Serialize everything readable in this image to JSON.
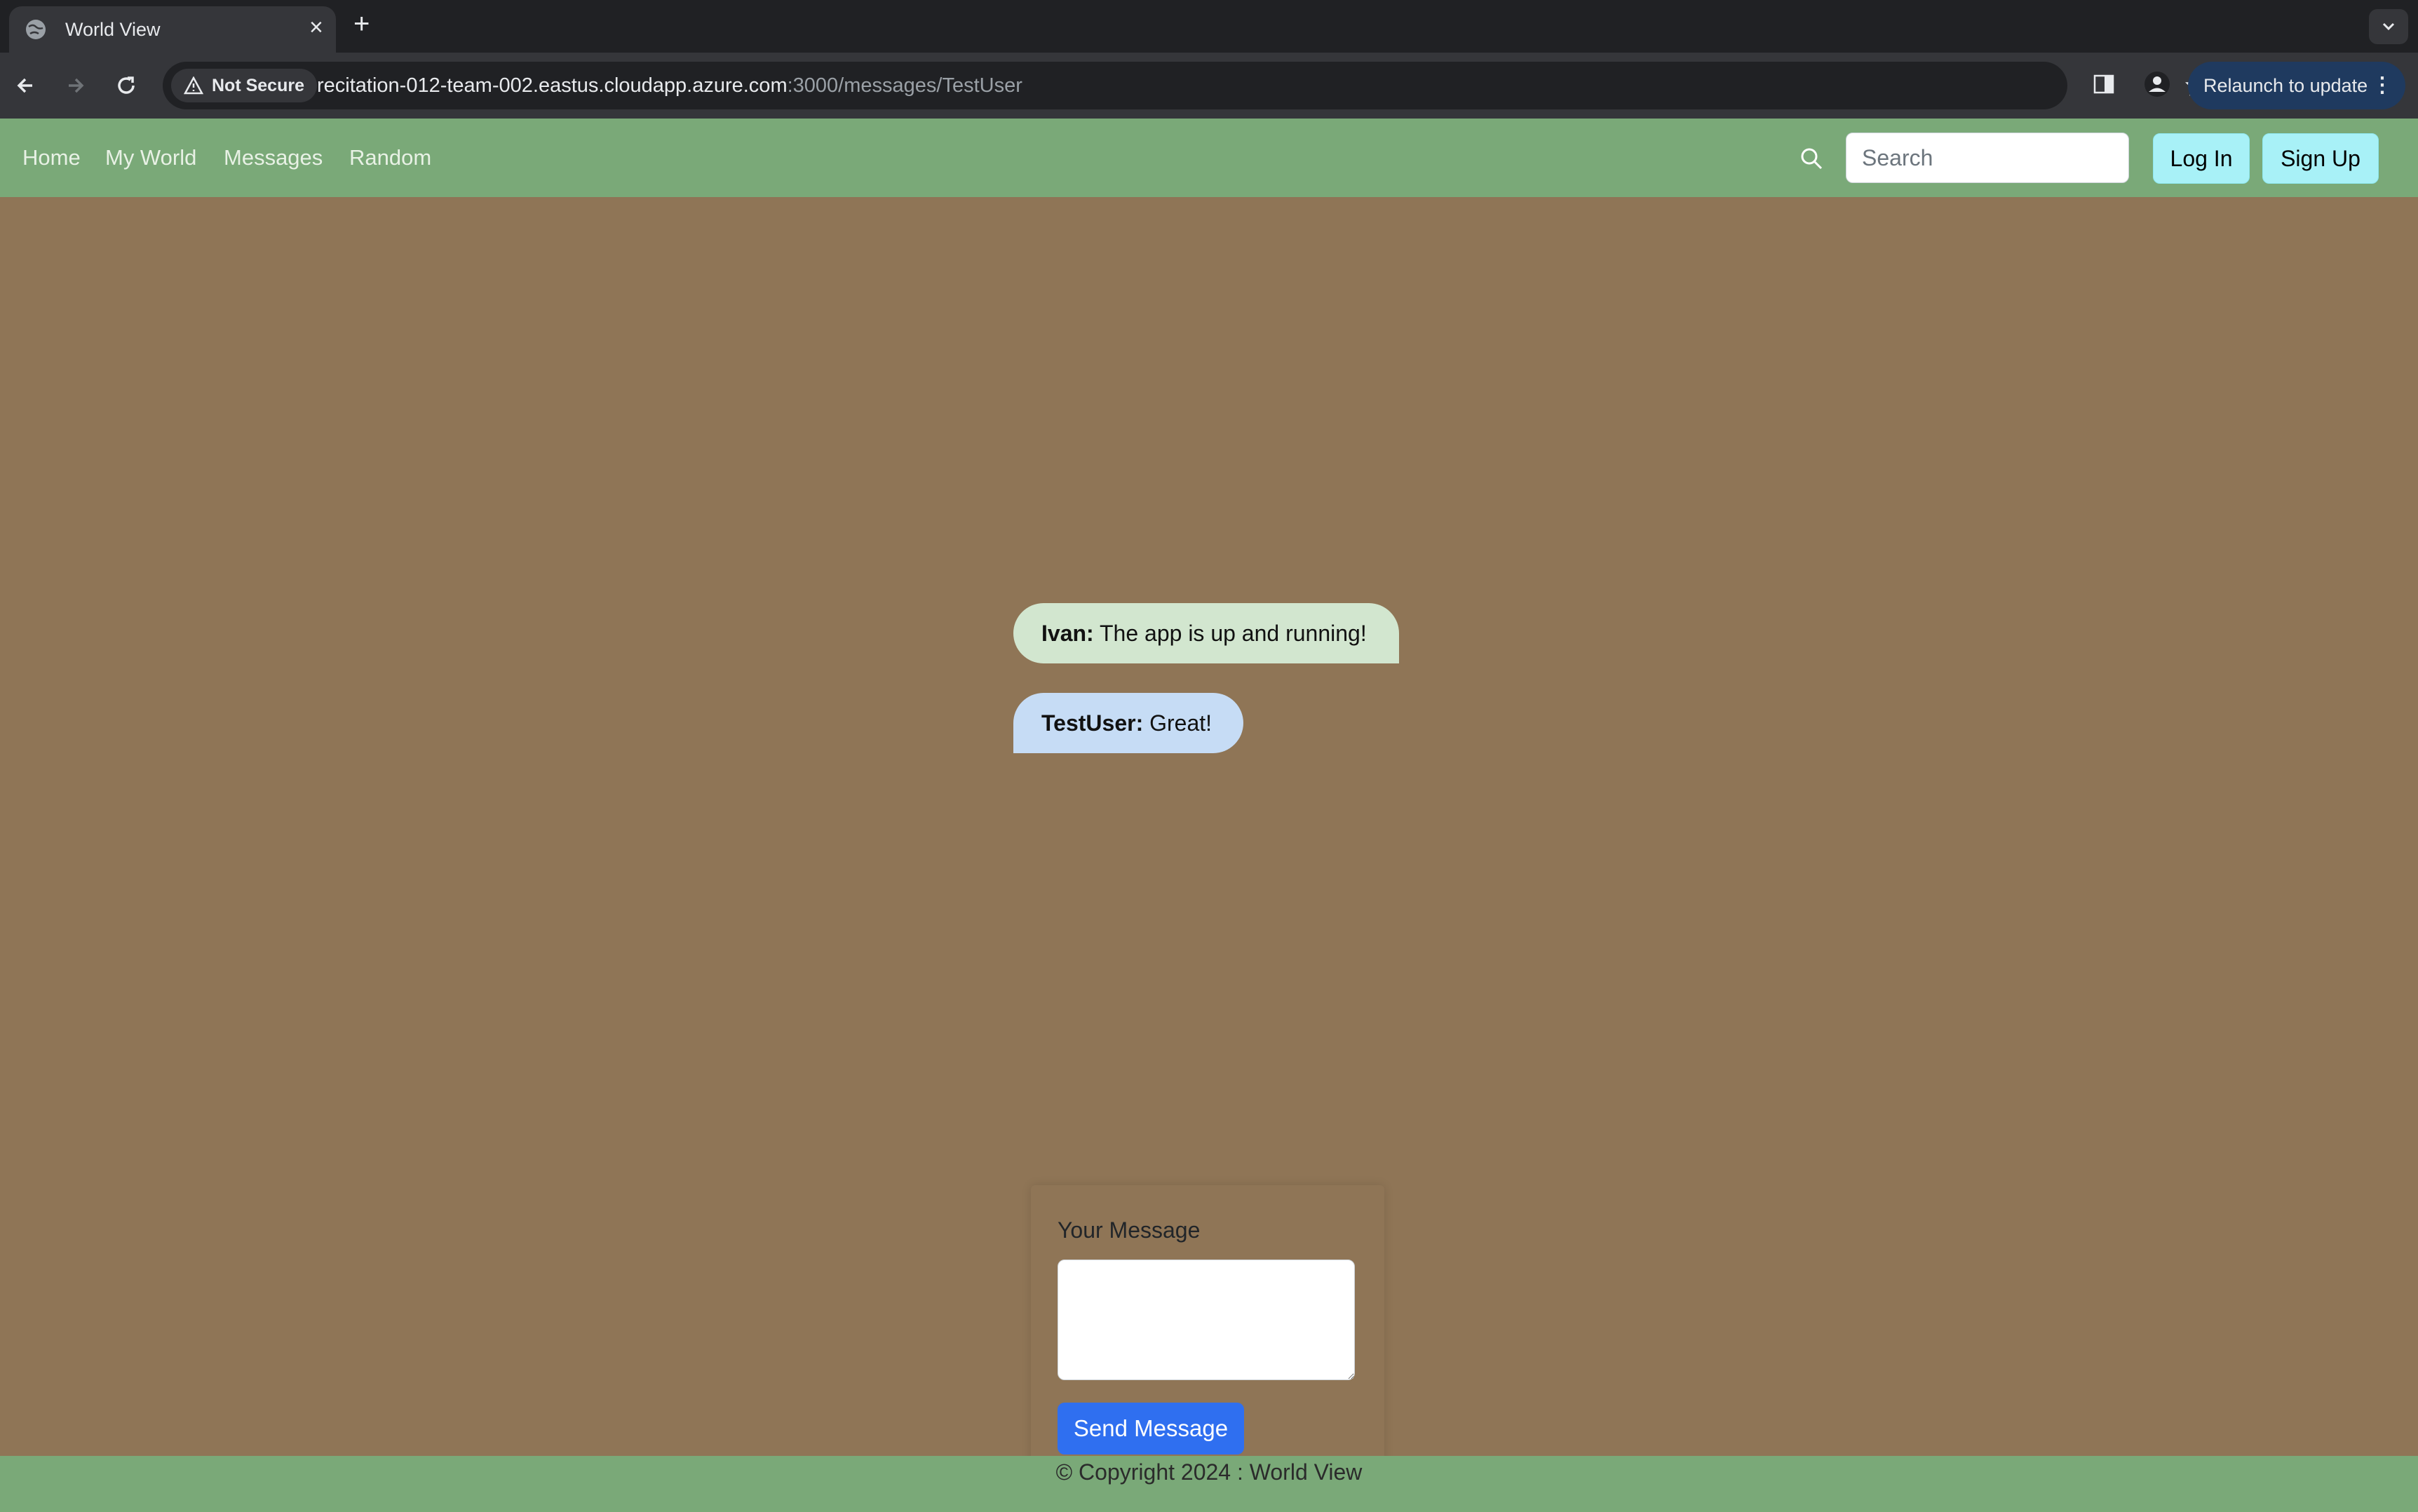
{
  "browser": {
    "tab_title": "World View",
    "security_label": "Not Secure",
    "url_host": "recitation-012-team-002.eastus.cloudapp.azure.com",
    "url_rest": ":3000/messages/TestUser",
    "relaunch_label": "Relaunch to update"
  },
  "nav": {
    "links": [
      "Home",
      "My World",
      "Messages",
      "Random"
    ],
    "search_placeholder": "Search",
    "login_label": "Log In",
    "signup_label": "Sign Up"
  },
  "messages": [
    {
      "sender": "Ivan:",
      "text": "The app is up and running!"
    },
    {
      "sender": "TestUser:",
      "text": "Great!"
    }
  ],
  "form": {
    "label": "Your Message",
    "message_value": "",
    "submit_label": "Send Message"
  },
  "footer": {
    "text": "© Copyright 2024 : World View"
  },
  "colors": {
    "page_bg": "#8f7556",
    "nav_bg": "#7aa978",
    "button_cyan": "#a8f1f7",
    "send_button": "#2f6ff0"
  }
}
